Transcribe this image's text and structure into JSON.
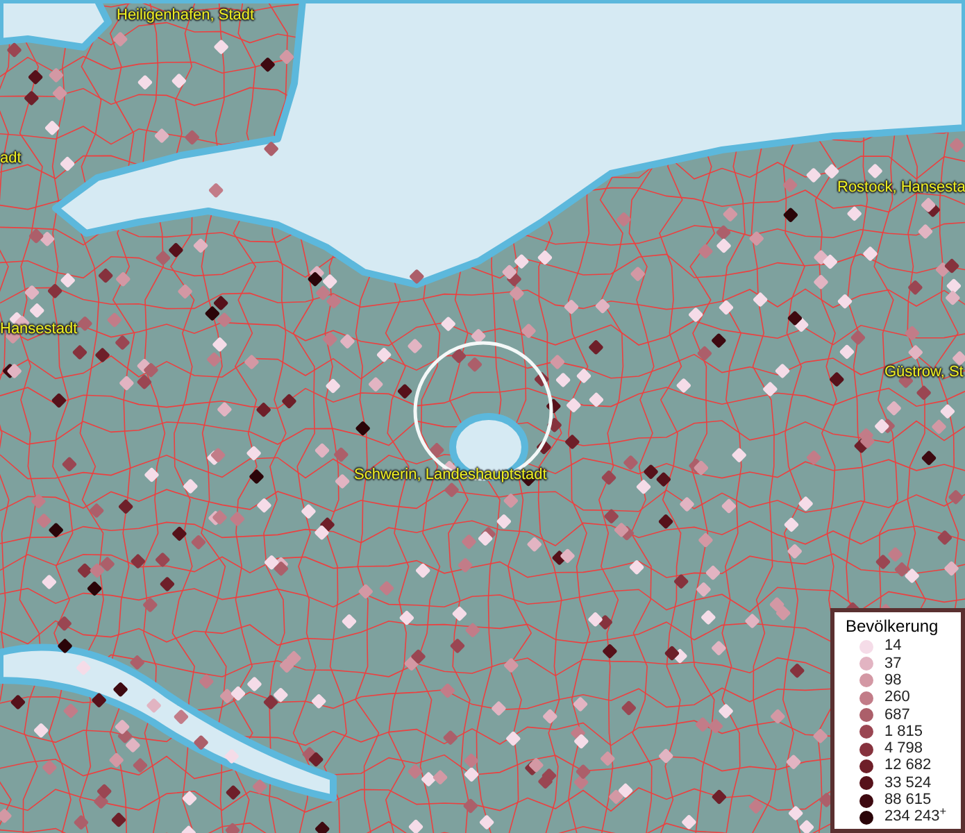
{
  "map": {
    "labels": [
      {
        "text": "Heiligenhafen, Stadt"
      },
      {
        "text": "adt"
      },
      {
        "text": "Rostock, Hansesta"
      },
      {
        "text": "Hansestadt"
      },
      {
        "text": "Güstrow, St"
      },
      {
        "text": "Schwerin, Landeshauptstadt"
      }
    ]
  },
  "legend": {
    "title": "Bevölkerung",
    "items": [
      {
        "value": "14",
        "color": "#f5dce8"
      },
      {
        "value": "37",
        "color": "#e2b4c2"
      },
      {
        "value": "98",
        "color": "#d398a4"
      },
      {
        "value": "260",
        "color": "#c27c88"
      },
      {
        "value": "687",
        "color": "#ac5f6a"
      },
      {
        "value": "1 815",
        "color": "#9a4652"
      },
      {
        "value": "4 798",
        "color": "#86323d"
      },
      {
        "value": "12 682",
        "color": "#6e1f29"
      },
      {
        "value": "33 524",
        "color": "#56111a"
      },
      {
        "value": "88 615",
        "color": "#3e0910"
      },
      {
        "value": "234 243$^{+}$",
        "color": "#2a0408"
      }
    ]
  }
}
